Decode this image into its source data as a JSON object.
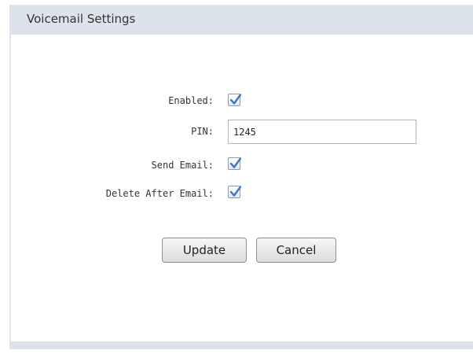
{
  "panel": {
    "title": "Voicemail Settings"
  },
  "form": {
    "enabled": {
      "label": "Enabled:",
      "checked": true
    },
    "pin": {
      "label": "PIN:",
      "value": "1245"
    },
    "send_email": {
      "label": "Send Email:",
      "checked": true
    },
    "delete_after_email": {
      "label": "Delete After Email:",
      "checked": true
    }
  },
  "buttons": {
    "update_label": "Update",
    "cancel_label": "Cancel"
  },
  "colors": {
    "header_bg": "#dde3eb",
    "check_mark": "#3a76c4"
  },
  "icons": {
    "checkmark": "check-icon"
  }
}
